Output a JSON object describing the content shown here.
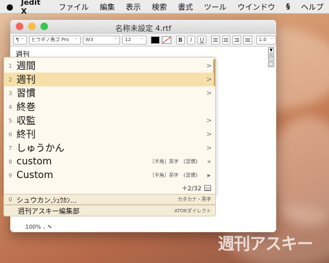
{
  "menubar": {
    "apple": "",
    "app": "Jedit X",
    "items": [
      "ファイル",
      "編集",
      "表示",
      "検索",
      "書式",
      "ツール",
      "ウインドウ"
    ],
    "atok": "§",
    "help": "ヘルプ"
  },
  "window": {
    "title": "名称未設定 4.rtf",
    "colors": {
      "close": "#fc605b",
      "minimize": "#fdbc40",
      "zoom": "#34c84a"
    }
  },
  "toolbar": {
    "para": "¶",
    "font": "ヒラギノ角ゴ Pro",
    "weight": "W3",
    "size": "12",
    "bold": "B",
    "italic": "I",
    "underline": "U",
    "spacing": "1.0"
  },
  "document": {
    "text": "週刊",
    "zoom": "100%"
  },
  "candidates": [
    {
      "num": "1",
      "text": "週間",
      "arrow": ">",
      "anno": ""
    },
    {
      "num": "2",
      "text": "週刊",
      "arrow": ">",
      "anno": ""
    },
    {
      "num": "3",
      "text": "習慣",
      "arrow": ">",
      "anno": ""
    },
    {
      "num": "4",
      "text": "終巻",
      "arrow": "",
      "anno": ""
    },
    {
      "num": "5",
      "text": "収監",
      "arrow": ">",
      "anno": ""
    },
    {
      "num": "6",
      "text": "終刊",
      "arrow": ">",
      "anno": ""
    },
    {
      "num": "7",
      "text": "しゅうかん",
      "arrow": ">",
      "anno": ""
    },
    {
      "num": "8",
      "text": "custom",
      "arrow": "»",
      "anno": "［半角］英字　《習慣》"
    },
    {
      "num": "9",
      "text": "Custom",
      "arrow": "▸",
      "anno": "［半角］英字　《習慣》"
    }
  ],
  "pageinfo": "＋2/32",
  "katakana": {
    "num": "0",
    "text": "シュウカン,ｼｭｳｶﾝ…",
    "anno": "カタカナ・英字"
  },
  "direct": {
    "text": "週刊アスキー編集部",
    "anno": "ATOKダイレクト"
  },
  "watermark": "週刊アスキー"
}
